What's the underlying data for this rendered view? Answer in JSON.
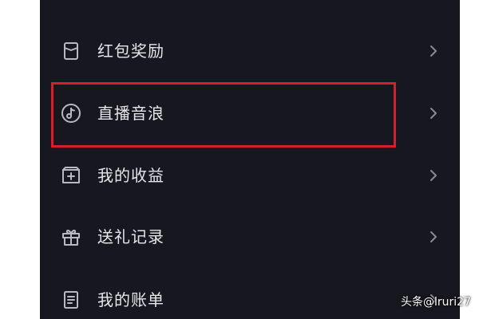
{
  "menu": {
    "items": [
      {
        "label": "红包奖励",
        "icon": "red-packet-icon"
      },
      {
        "label": "直播音浪",
        "icon": "sound-wave-note-icon"
      },
      {
        "label": "我的收益",
        "icon": "earnings-icon"
      },
      {
        "label": "送礼记录",
        "icon": "gift-icon"
      },
      {
        "label": "我的账单",
        "icon": "bill-icon"
      }
    ]
  },
  "highlight": {
    "target": "直播音浪",
    "color": "#d4202c"
  },
  "watermark": {
    "text": "头条@lruri27"
  },
  "colors": {
    "background": "#17171f",
    "text": "#e6e6ea",
    "icon": "#b9b9c0"
  }
}
